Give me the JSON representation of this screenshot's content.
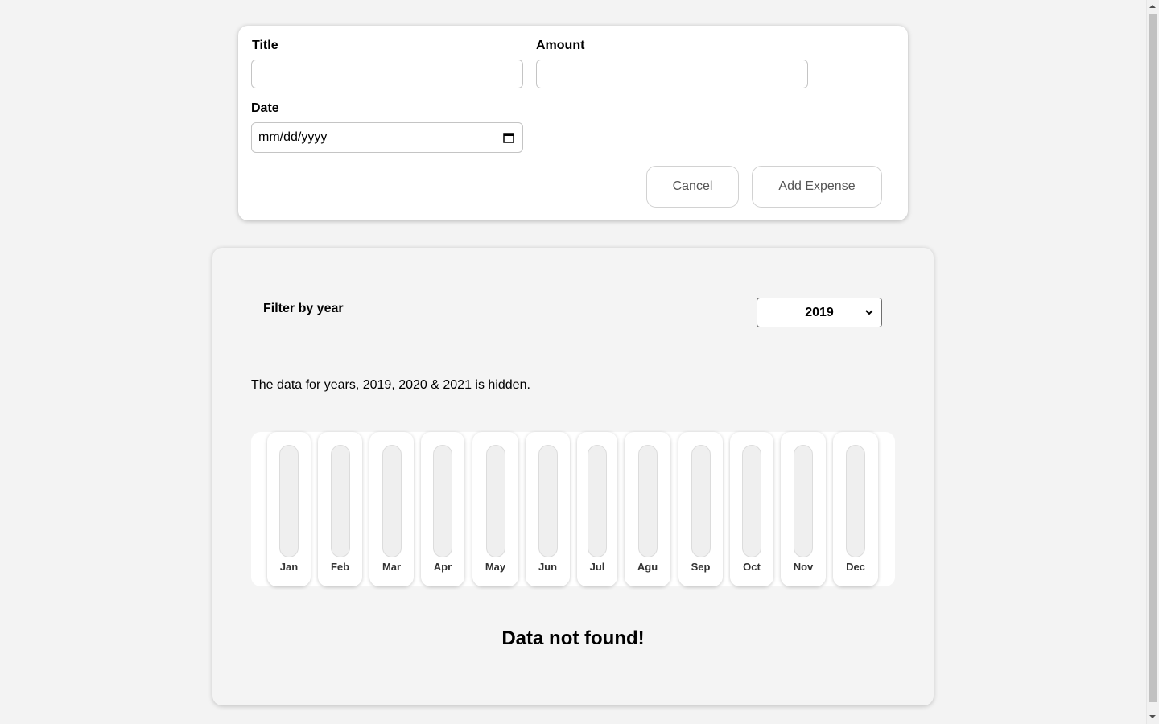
{
  "form": {
    "title_label": "Title",
    "title_value": "",
    "amount_label": "Amount",
    "amount_value": "",
    "date_label": "Date",
    "date_value": "mm/dd/yyyy",
    "cancel_label": "Cancel",
    "submit_label": "Add Expense"
  },
  "filter": {
    "label": "Filter by year",
    "selected_year": "2019"
  },
  "notice": "The data for years, 2019, 2020 & 2021 is hidden.",
  "chart_data": {
    "type": "bar",
    "categories": [
      "Jan",
      "Feb",
      "Mar",
      "Apr",
      "May",
      "Jun",
      "Jul",
      "Agu",
      "Sep",
      "Oct",
      "Nov",
      "Dec"
    ],
    "values": [
      0,
      0,
      0,
      0,
      0,
      0,
      0,
      0,
      0,
      0,
      0,
      0
    ]
  },
  "empty_message": "Data not found!",
  "icons": {
    "date_picker": "calendar-icon",
    "select_toggle": "chevron-down-icon"
  }
}
